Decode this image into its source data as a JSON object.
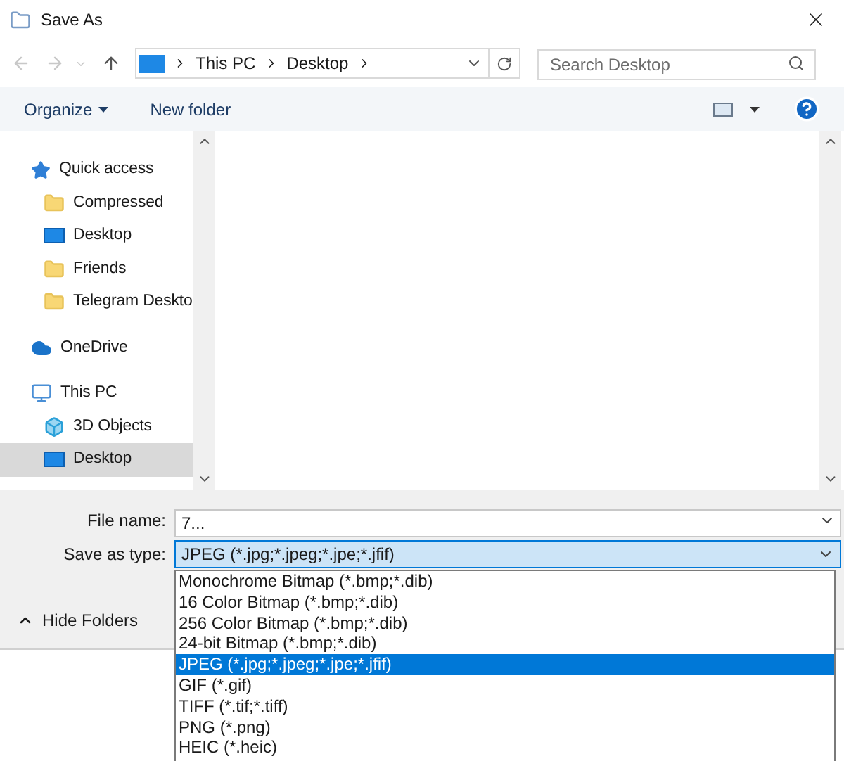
{
  "window": {
    "title": "Save As"
  },
  "address_bar": {
    "crumbs": [
      "This PC",
      "Desktop"
    ]
  },
  "search": {
    "placeholder": "Search Desktop"
  },
  "toolbar": {
    "organize": "Organize",
    "new_folder": "New folder"
  },
  "sidebar": {
    "items": [
      {
        "label": "Quick access",
        "kind": "star",
        "selected": false,
        "children": [
          {
            "label": "Compressed",
            "kind": "folder",
            "selected": false
          },
          {
            "label": "Desktop",
            "kind": "desktop",
            "selected": false
          },
          {
            "label": "Friends",
            "kind": "folder",
            "selected": false
          },
          {
            "label": "Telegram Deskto",
            "kind": "folder",
            "selected": false
          }
        ]
      },
      {
        "label": "OneDrive",
        "kind": "cloud",
        "selected": false
      },
      {
        "label": "This PC",
        "kind": "pc",
        "selected": false,
        "children": [
          {
            "label": "3D Objects",
            "kind": "cube",
            "selected": false
          },
          {
            "label": "Desktop",
            "kind": "desktop",
            "selected": true
          }
        ]
      }
    ]
  },
  "file_name": {
    "label": "File name:",
    "value": "7..."
  },
  "save_as_type": {
    "label": "Save as type:",
    "value": "JPEG (*.jpg;*.jpeg;*.jpe;*.jfif)",
    "expanded": true,
    "options": [
      {
        "label": "Monochrome Bitmap (*.bmp;*.dib)",
        "selected": false
      },
      {
        "label": "16 Color Bitmap (*.bmp;*.dib)",
        "selected": false
      },
      {
        "label": "256 Color Bitmap (*.bmp;*.dib)",
        "selected": false
      },
      {
        "label": "24-bit Bitmap (*.bmp;*.dib)",
        "selected": false
      },
      {
        "label": "JPEG (*.jpg;*.jpeg;*.jpe;*.jfif)",
        "selected": true
      },
      {
        "label": "GIF (*.gif)",
        "selected": false
      },
      {
        "label": "TIFF (*.tif;*.tiff)",
        "selected": false
      },
      {
        "label": "PNG (*.png)",
        "selected": false
      },
      {
        "label": "HEIC (*.heic)",
        "selected": false
      }
    ]
  },
  "hide_folders": "Hide Folders"
}
